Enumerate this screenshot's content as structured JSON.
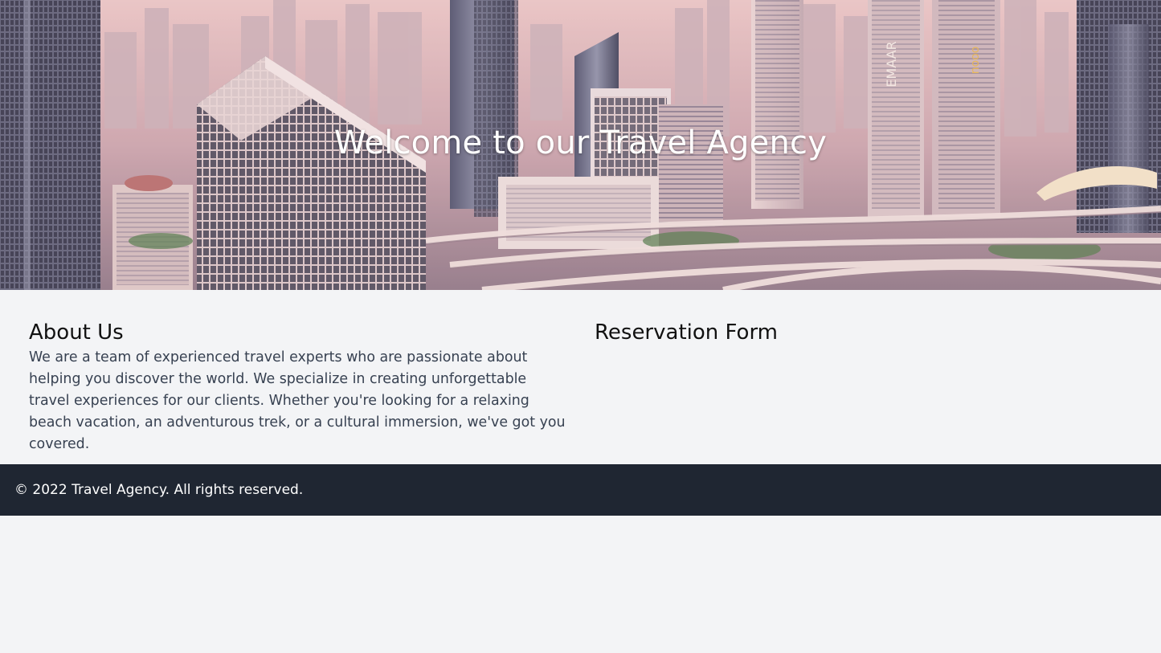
{
  "hero": {
    "title": "Welcome to our Travel Agency",
    "tower_sign_1": "EMAAR",
    "tower_sign_2": "nooo"
  },
  "about": {
    "heading": "About Us",
    "text": "We are a team of experienced travel experts who are passionate about helping you discover the world. We specialize in creating unforgettable travel experiences for our clients. Whether you're looking for a relaxing beach vacation, an adventurous trek, or a cultural immersion, we've got you covered."
  },
  "reservation": {
    "heading": "Reservation Form"
  },
  "footer": {
    "copyright": "© 2022 Travel Agency. All rights reserved."
  },
  "colors": {
    "page_background": "#f3f4f6",
    "footer_background": "#1f2632",
    "hero_text": "#ffffff",
    "body_text": "#374151"
  }
}
